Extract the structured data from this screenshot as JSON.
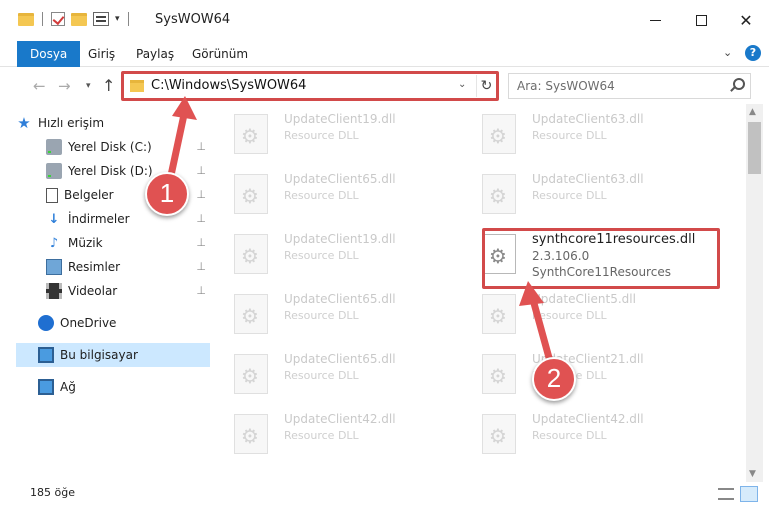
{
  "window": {
    "title": "SysWOW64",
    "minimize": "–",
    "maximize": "☐",
    "close": "✕"
  },
  "ribbon": {
    "tabs": [
      "Dosya",
      "Giriş",
      "Paylaş",
      "Görünüm"
    ],
    "active_tab": "Dosya",
    "expand_glyph": "⌄",
    "help_glyph": "?"
  },
  "address": {
    "path": "C:\\Windows\\SysWOW64",
    "dropdown_glyph": "⌄",
    "refresh_glyph": "↻",
    "back_glyph": "←",
    "forward_glyph": "→",
    "recent_glyph": "⌄",
    "up_glyph": "↑"
  },
  "search": {
    "placeholder": "Ara: SysWOW64"
  },
  "navpane": {
    "quick_access": "Hızlı erişim",
    "items": [
      {
        "label": "Yerel Disk (C:)",
        "icon": "drive-icon",
        "pinned": true
      },
      {
        "label": "Yerel Disk (D:)",
        "icon": "drive-icon",
        "pinned": true
      },
      {
        "label": "Belgeler",
        "icon": "documents-icon",
        "pinned": true
      },
      {
        "label": "İndirmeler",
        "icon": "downloads-icon",
        "pinned": true
      },
      {
        "label": "Müzik",
        "icon": "music-icon",
        "pinned": true
      },
      {
        "label": "Resimler",
        "icon": "pictures-icon",
        "pinned": true
      },
      {
        "label": "Videolar",
        "icon": "videos-icon",
        "pinned": true
      }
    ],
    "onedrive": "OneDrive",
    "this_pc": "Bu bilgisayar",
    "network": "Ağ",
    "pin_glyph": "📌"
  },
  "files": {
    "left_column": [
      {
        "name": "UpdateClient19.dll",
        "type": "Resource DLL"
      },
      {
        "name": "UpdateClient65.dll",
        "type": "Resource DLL"
      },
      {
        "name": "UpdateClient19.dll",
        "type": "Resource DLL"
      },
      {
        "name": "UpdateClient65.dll",
        "type": "Resource DLL"
      },
      {
        "name": "UpdateClient65.dll",
        "type": "Resource DLL"
      },
      {
        "name": "UpdateClient42.dll",
        "type": "Resource DLL"
      }
    ],
    "right_column": [
      {
        "name": "UpdateClient63.dll",
        "type": "Resource DLL"
      },
      {
        "name": "UpdateClient63.dll",
        "type": "Resource DLL"
      },
      {
        "name": "synthcore11resources.dll",
        "type": "2.3.106.0",
        "product": "SynthCore11Resources"
      },
      {
        "name": "UpdateClient5.dll",
        "type": "Resource DLL"
      },
      {
        "name": "UpdateClient21.dll",
        "type": "Resource DLL"
      },
      {
        "name": "UpdateClient42.dll",
        "type": "Resource DLL"
      }
    ]
  },
  "status": {
    "count": "185 öğe"
  },
  "annotations": {
    "marker1": "1",
    "marker2": "2",
    "color": "#e05252"
  },
  "colors": {
    "accent": "#1979ca",
    "selected_bg": "#cce8ff",
    "highlight_border": "#d24a4a"
  }
}
